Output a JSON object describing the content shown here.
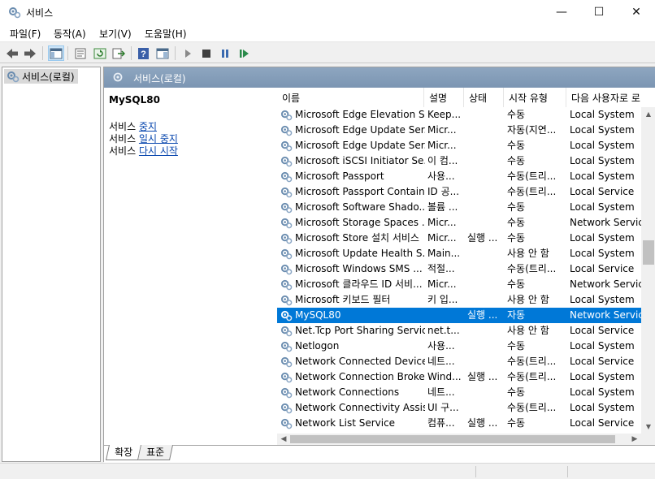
{
  "window": {
    "title": "서비스",
    "minimize": "—",
    "maximize": "☐",
    "close": "✕"
  },
  "menu": [
    "파일(F)",
    "동작(A)",
    "보기(V)",
    "도움말(H)"
  ],
  "tree": {
    "root": "서비스(로컬)"
  },
  "panel_header": "서비스(로컬)",
  "description": {
    "service_name": "MySQL80",
    "lines": [
      {
        "prefix": "서비스 ",
        "link": "중지"
      },
      {
        "prefix": "서비스 ",
        "link": "일시 중지"
      },
      {
        "prefix": "서비스 ",
        "link": "다시 시작"
      }
    ]
  },
  "columns": [
    "이름",
    "설명",
    "상태",
    "시작 유형",
    "다음 사용자로 로"
  ],
  "sort_indicator": "^",
  "rows": [
    {
      "name": "Microsoft Edge Elevation S...",
      "desc": "Keep...",
      "status": "",
      "start": "수동",
      "logon": "Local System"
    },
    {
      "name": "Microsoft Edge Update Ser...",
      "desc": "Micr...",
      "status": "",
      "start": "자동(지연...",
      "logon": "Local System"
    },
    {
      "name": "Microsoft Edge Update Ser...",
      "desc": "Micr...",
      "status": "",
      "start": "수동",
      "logon": "Local System"
    },
    {
      "name": "Microsoft iSCSI Initiator Se...",
      "desc": "이 컴...",
      "status": "",
      "start": "수동",
      "logon": "Local System"
    },
    {
      "name": "Microsoft Passport",
      "desc": "사용...",
      "status": "",
      "start": "수동(트리...",
      "logon": "Local System"
    },
    {
      "name": "Microsoft Passport Container",
      "desc": "ID 공...",
      "status": "",
      "start": "수동(트리...",
      "logon": "Local Service"
    },
    {
      "name": "Microsoft Software Shado...",
      "desc": "볼륨 ...",
      "status": "",
      "start": "수동",
      "logon": "Local System"
    },
    {
      "name": "Microsoft Storage Spaces ...",
      "desc": "Micr...",
      "status": "",
      "start": "수동",
      "logon": "Network Service"
    },
    {
      "name": "Microsoft Store 설치 서비스",
      "desc": "Micr...",
      "status": "실행 ...",
      "start": "수동",
      "logon": "Local System"
    },
    {
      "name": "Microsoft Update Health S...",
      "desc": "Main...",
      "status": "",
      "start": "사용 안 함",
      "logon": "Local System"
    },
    {
      "name": "Microsoft Windows SMS ...",
      "desc": "적절...",
      "status": "",
      "start": "수동(트리...",
      "logon": "Local Service"
    },
    {
      "name": "Microsoft 클라우드 ID 서비...",
      "desc": "Micr...",
      "status": "",
      "start": "수동",
      "logon": "Network Service"
    },
    {
      "name": "Microsoft 키보드 필터",
      "desc": "키 입...",
      "status": "",
      "start": "사용 안 함",
      "logon": "Local System"
    },
    {
      "name": "MySQL80",
      "desc": "",
      "status": "실행 ...",
      "start": "자동",
      "logon": "Network Service",
      "selected": true
    },
    {
      "name": "Net.Tcp Port Sharing Service",
      "desc": "net.t...",
      "status": "",
      "start": "사용 안 함",
      "logon": "Local Service"
    },
    {
      "name": "Netlogon",
      "desc": "사용...",
      "status": "",
      "start": "수동",
      "logon": "Local System"
    },
    {
      "name": "Network Connected Device...",
      "desc": "네트...",
      "status": "",
      "start": "수동(트리...",
      "logon": "Local Service"
    },
    {
      "name": "Network Connection Broker",
      "desc": "Wind...",
      "status": "실행 ...",
      "start": "수동(트리...",
      "logon": "Local System"
    },
    {
      "name": "Network Connections",
      "desc": "네트...",
      "status": "",
      "start": "수동",
      "logon": "Local System"
    },
    {
      "name": "Network Connectivity Assis...",
      "desc": "UI 구...",
      "status": "",
      "start": "수동(트리...",
      "logon": "Local System"
    },
    {
      "name": "Network List Service",
      "desc": "컴퓨...",
      "status": "실행 ...",
      "start": "수동",
      "logon": "Local Service"
    }
  ],
  "tabs": [
    "확장",
    "표준"
  ],
  "colors": {
    "selection": "#0078d7",
    "header_band": "#7b95b2",
    "link": "#0645ad"
  },
  "icons": [
    "services-gear-icon",
    "back-arrow-icon",
    "forward-arrow-icon",
    "console-tree-icon",
    "properties-icon",
    "refresh-icon",
    "export-list-icon",
    "help-icon",
    "view-icon",
    "play-icon",
    "stop-icon",
    "pause-icon",
    "restart-icon"
  ]
}
